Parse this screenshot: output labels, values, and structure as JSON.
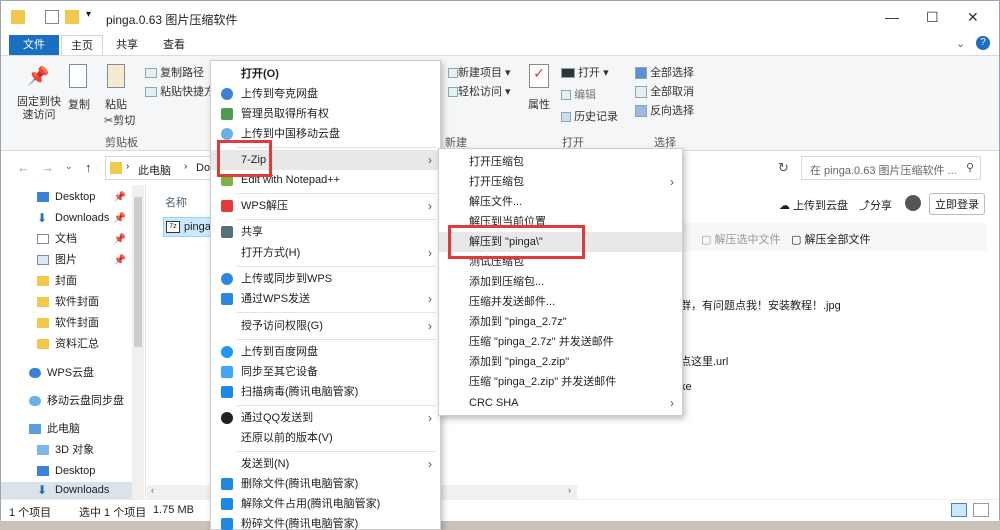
{
  "window": {
    "title": "pinga.0.63 图片压缩软件",
    "controls": {
      "minimize": "—",
      "maximize": "☐",
      "close": "✕"
    }
  },
  "ribbon": {
    "tabs": [
      "文件",
      "主页",
      "共享",
      "查看"
    ],
    "clipboard": {
      "pin_label": "固定到快\n速访问",
      "copy_label": "复制",
      "paste_label": "粘贴",
      "copy_path": "复制路径",
      "paste_shortcut": "粘贴快捷方",
      "cut": "剪切",
      "group": "剪贴板"
    },
    "new": {
      "new_item": "新建项目 ▾",
      "easy_access": "轻松访问 ▾",
      "group": "新建"
    },
    "open": {
      "properties": "属性",
      "open": "打开 ▾",
      "edit": "编辑",
      "history": "历史记录",
      "group": "打开"
    },
    "select": {
      "select_all": "全部选择",
      "select_none": "全部取消",
      "invert": "反向选择",
      "group": "选择"
    }
  },
  "address": {
    "path_root": "此电脑",
    "path_next": "Dov",
    "search_placeholder": "在 pinga.0.63 图片压缩软件 ..."
  },
  "nav": {
    "items": [
      {
        "label": "Desktop",
        "pinned": true
      },
      {
        "label": "Downloads",
        "pinned": true
      },
      {
        "label": "文档",
        "pinned": true
      },
      {
        "label": "图片",
        "pinned": true
      },
      {
        "label": "封面",
        "pinned": false
      },
      {
        "label": "软件封面",
        "pinned": false
      },
      {
        "label": "软件封面",
        "pinned": false
      },
      {
        "label": "资料汇总",
        "pinned": false
      },
      {
        "label": "WPS云盘",
        "pinned": false
      },
      {
        "label": "移动云盘同步盘",
        "pinned": false
      },
      {
        "label": "此电脑",
        "pinned": false
      },
      {
        "label": "3D 对象",
        "pinned": false
      },
      {
        "label": "Desktop",
        "pinned": false
      },
      {
        "label": "Downloads",
        "pinned": false
      }
    ]
  },
  "content": {
    "column_name": "名称",
    "file_name": "pinga",
    "upload": "上传到云盘",
    "share": "分享",
    "login": "立即登录",
    "extract_selected": "解压选中文件",
    "extract_all": "解压全部文件",
    "rows": [
      "群，有问题点我！安装教程！.jpg",
      "点这里.url",
      "xe"
    ]
  },
  "status": {
    "items_count": "1 个项目",
    "selected": "选中 1 个项目",
    "size": "1.75 MB"
  },
  "context_menu": {
    "items": [
      {
        "label": "打开(O)",
        "bold": true
      },
      {
        "label": "上传到夸克网盘"
      },
      {
        "label": "管理员取得所有权"
      },
      {
        "label": "上传到中国移动云盘"
      },
      {
        "label": "7-Zip",
        "submenu": true
      },
      {
        "label": "Edit with Notepad++"
      },
      {
        "label": "WPS解压",
        "submenu": true
      },
      {
        "label": "共享"
      },
      {
        "label": "打开方式(H)",
        "submenu": true
      },
      {
        "label": "上传或同步到WPS"
      },
      {
        "label": "通过WPS发送",
        "submenu": true
      },
      {
        "label": "授予访问权限(G)",
        "submenu": true
      },
      {
        "label": "上传到百度网盘"
      },
      {
        "label": "同步至其它设备"
      },
      {
        "label": "扫描病毒(腾讯电脑管家)"
      },
      {
        "label": "通过QQ发送到",
        "submenu": true
      },
      {
        "label": "还原以前的版本(V)"
      },
      {
        "label": "发送到(N)",
        "submenu": true
      },
      {
        "label": "删除文件(腾讯电脑管家)"
      },
      {
        "label": "解除文件占用(腾讯电脑管家)"
      },
      {
        "label": "粉碎文件(腾讯电脑管家)"
      }
    ]
  },
  "sevenzip_menu": {
    "items": [
      {
        "label": "打开压缩包"
      },
      {
        "label": "打开压缩包",
        "submenu": true
      },
      {
        "label": "解压文件..."
      },
      {
        "label": "解压到当前位置"
      },
      {
        "label": "解压到 \"pinga\\\""
      },
      {
        "label": "测试压缩包"
      },
      {
        "label": "添加到压缩包..."
      },
      {
        "label": "压缩并发送邮件..."
      },
      {
        "label": "添加到 \"pinga_2.7z\""
      },
      {
        "label": "压缩 \"pinga_2.7z\" 并发送邮件"
      },
      {
        "label": "添加到 \"pinga_2.zip\""
      },
      {
        "label": "压缩 \"pinga_2.zip\" 并发送邮件"
      },
      {
        "label": "CRC SHA",
        "submenu": true
      }
    ]
  },
  "colors": {
    "accent": "#1a70c0",
    "highlight_box": "#e03a3a",
    "folder": "#f2c94c"
  }
}
